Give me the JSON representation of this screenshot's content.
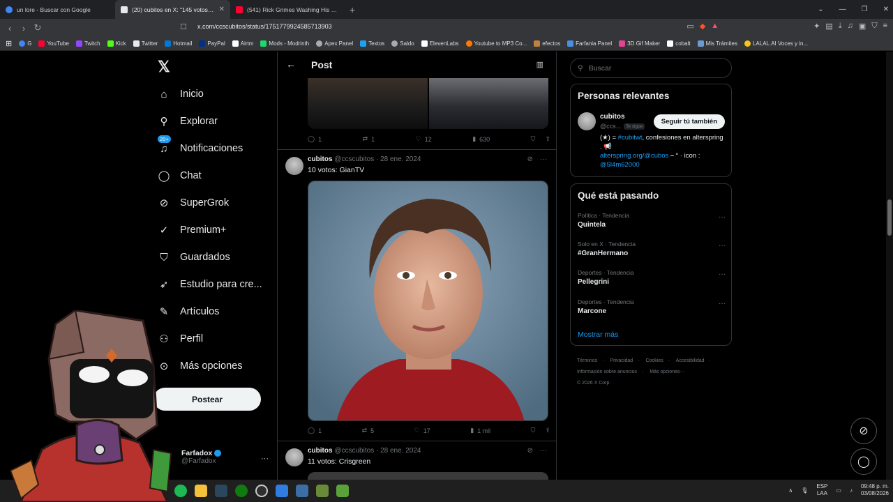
{
  "browser": {
    "tabs": [
      {
        "title": "un lore - Buscar con Google",
        "color": "#4285f4"
      },
      {
        "title": "(20) cubitos en X: \"145 votos: Fa",
        "color": "#e7e9ea"
      },
      {
        "title": "(541) Rick Grimes Washing His Face I",
        "color": "#ff0033"
      }
    ],
    "url": "x.com/ccscubitos/status/1751779924585713903",
    "bookmarks": [
      "G",
      "YouTube",
      "Twitch",
      "Kick",
      "Twitter",
      "Hotmail",
      "PayPal",
      "Airtm",
      "Mods - Modrinth",
      "Apex Panel",
      "Textos",
      "Saldo",
      "ElevenLabs",
      "Youtube to MP3 Co...",
      "efectos",
      "Farfania Panel",
      "3D Gif Maker",
      "cobalt",
      "Mis Trámites",
      "LALAL.AI Voces y in..."
    ]
  },
  "nav": {
    "items": [
      {
        "label": "Inicio",
        "icon": "home-icon"
      },
      {
        "label": "Explorar",
        "icon": "search-icon"
      },
      {
        "label": "Notificaciones",
        "icon": "bell-icon"
      },
      {
        "label": "Chat",
        "icon": "chat-icon"
      },
      {
        "label": "SuperGrok",
        "icon": "grok-icon"
      },
      {
        "label": "Premium+",
        "icon": "verified-icon"
      },
      {
        "label": "Guardados",
        "icon": "bookmark-icon"
      },
      {
        "label": "Estudio para cre...",
        "icon": "rocket-icon"
      },
      {
        "label": "Artículos",
        "icon": "article-icon"
      },
      {
        "label": "Perfil",
        "icon": "person-icon"
      },
      {
        "label": "Más opciones",
        "icon": "more-icon"
      }
    ],
    "badge": "20+",
    "post_label": "Postear",
    "profile": {
      "name": "Farfadox",
      "handle": "@Farfadox"
    }
  },
  "feed": {
    "title": "Post",
    "top_actions": {
      "replies": "1",
      "reposts": "1",
      "likes": "12",
      "views": "630"
    },
    "tweet1": {
      "name": "cubitos",
      "handle": "@ccscubitos",
      "date": "· 28 ene. 2024",
      "text": "10 votos: GianTV",
      "actions": {
        "replies": "1",
        "reposts": "5",
        "likes": "17",
        "views": "1 mil"
      }
    },
    "tweet2": {
      "name": "cubitos",
      "handle": "@ccscubitos",
      "date": "· 28 ene. 2024",
      "text": "11 votos: Crisgreen"
    }
  },
  "sidebar": {
    "search_placeholder": "Buscar",
    "relevant": {
      "title": "Personas relevantes",
      "name": "cubitos",
      "handle": "@ccs...",
      "follows_you": "Te sigue",
      "follow_label": "Seguir tú también",
      "bio_a": "(★) = ",
      "bio_link1": "#cubitwt",
      "bio_b": ", confesiones en alterspring . 📢",
      "bio_link2": "alterspring.org/@cubos",
      "bio_c": " ⎯ ° · icon :",
      "bio_link3": "@5l4m62000"
    },
    "trends": {
      "title": "Qué está pasando",
      "items": [
        {
          "category": "Política · Tendencia",
          "topic": "Quintela"
        },
        {
          "category": "Solo en X · Tendencia",
          "topic": "#GranHermano"
        },
        {
          "category": "Deportes · Tendencia",
          "topic": "Pellegrini"
        },
        {
          "category": "Deportes · Tendencia",
          "topic": "Marcone"
        }
      ],
      "show_more": "Mostrar más"
    },
    "footer": [
      "Términos",
      "Privacidad",
      "Cookies",
      "Accesibilidad",
      "Información sobre anuncios",
      "Más opciones···",
      "© 2026 X Corp."
    ]
  },
  "taskbar": {
    "lang1": "ESP",
    "lang2": "LAA",
    "time": "09:48 p. m.",
    "date": "03/08/2026"
  }
}
